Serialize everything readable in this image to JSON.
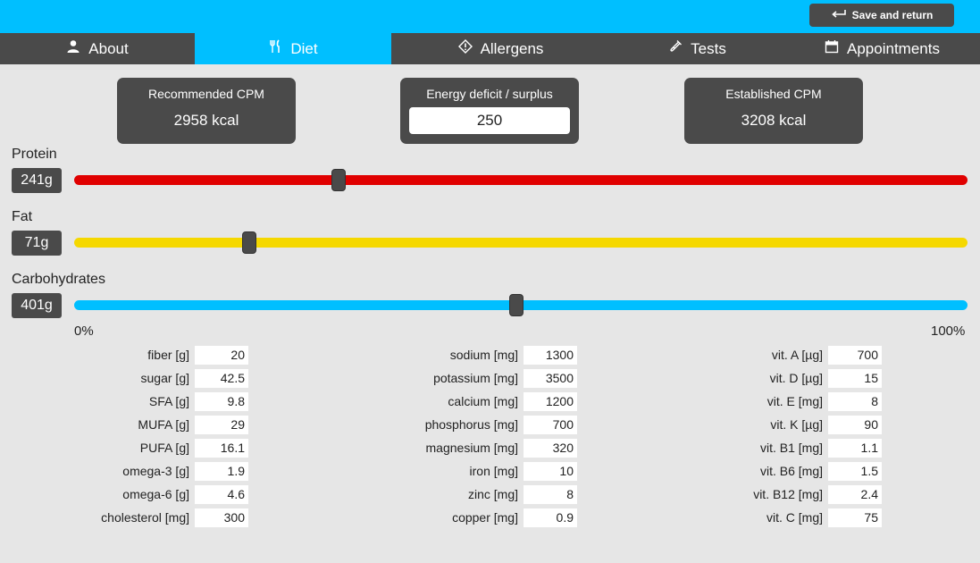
{
  "header": {
    "save_label": "Save and return"
  },
  "tabs": [
    {
      "label": "About",
      "icon": "person-icon"
    },
    {
      "label": "Diet",
      "icon": "fork-knife-icon",
      "active": true
    },
    {
      "label": "Allergens",
      "icon": "warning-diamond-icon"
    },
    {
      "label": "Tests",
      "icon": "test-tube-icon"
    },
    {
      "label": "Appointments",
      "icon": "calendar-icon"
    }
  ],
  "energy": {
    "recommended": {
      "title": "Recommended CPM",
      "value": "2958 kcal"
    },
    "deficit": {
      "title": "Energy deficit / surplus",
      "value": "250"
    },
    "established": {
      "title": "Established CPM",
      "value": "3208 kcal"
    }
  },
  "macros": [
    {
      "label": "Protein",
      "value": "241g",
      "level": 0.296,
      "color": "#e00000"
    },
    {
      "label": "Fat",
      "value": "71g",
      "level": 0.196,
      "color": "#f5d800"
    },
    {
      "label": "Carbohydrates",
      "value": "401g",
      "level": 0.495,
      "color": "#00bfff"
    }
  ],
  "scale": {
    "min": "0%",
    "max": "100%"
  },
  "nutrients": {
    "col1": [
      {
        "label": "fiber [g]",
        "value": "20"
      },
      {
        "label": "sugar [g]",
        "value": "42.5"
      },
      {
        "label": "SFA [g]",
        "value": "9.8"
      },
      {
        "label": "MUFA [g]",
        "value": "29"
      },
      {
        "label": "PUFA [g]",
        "value": "16.1"
      },
      {
        "label": "omega-3 [g]",
        "value": "1.9"
      },
      {
        "label": "omega-6 [g]",
        "value": "4.6"
      },
      {
        "label": "cholesterol [mg]",
        "value": "300"
      }
    ],
    "col2": [
      {
        "label": "sodium [mg]",
        "value": "1300"
      },
      {
        "label": "potassium [mg]",
        "value": "3500"
      },
      {
        "label": "calcium [mg]",
        "value": "1200"
      },
      {
        "label": "phosphorus [mg]",
        "value": "700"
      },
      {
        "label": "magnesium [mg]",
        "value": "320"
      },
      {
        "label": "iron [mg]",
        "value": "10"
      },
      {
        "label": "zinc [mg]",
        "value": "8"
      },
      {
        "label": "copper [mg]",
        "value": "0.9"
      }
    ],
    "col3": [
      {
        "label": "vit. A [µg]",
        "value": "700"
      },
      {
        "label": "vit. D [µg]",
        "value": "15"
      },
      {
        "label": "vit. E [mg]",
        "value": "8"
      },
      {
        "label": "vit. K [µg]",
        "value": "90"
      },
      {
        "label": "vit. B1 [mg]",
        "value": "1.1"
      },
      {
        "label": "vit. B6 [mg]",
        "value": "1.5"
      },
      {
        "label": "vit. B12 [mg]",
        "value": "2.4"
      },
      {
        "label": "vit. C [mg]",
        "value": "75"
      }
    ]
  }
}
